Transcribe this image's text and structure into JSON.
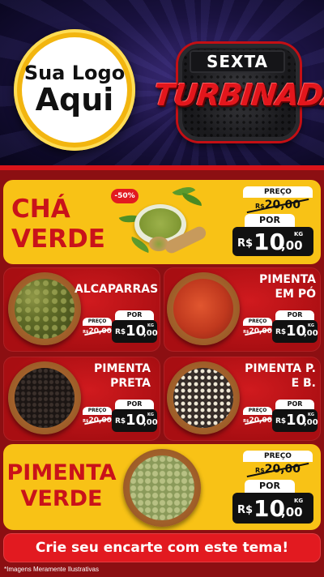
{
  "header": {
    "logo_line1": "Sua Logo",
    "logo_line2": "Aqui",
    "badge_top": "SEXTA",
    "badge_bottom": "TURBINADA"
  },
  "products": [
    {
      "name_line1": "CHÁ",
      "name_line2": "VERDE",
      "discount": "-50%",
      "preco_label": "PREÇO",
      "old_price_currency": "R$",
      "old_price": "20,00",
      "por_label": "POR",
      "currency": "R$",
      "price_int": "10",
      "price_dec": ",00",
      "unit": "KG"
    },
    {
      "name_line1": "ALCAPARRAS",
      "name_line2": "",
      "preco_label": "PREÇO",
      "old_price_currency": "R$",
      "old_price": "20,00",
      "por_label": "POR",
      "currency": "R$",
      "price_int": "10",
      "price_dec": ",00",
      "unit": "KG"
    },
    {
      "name_line1": "PIMENTA",
      "name_line2": "EM PÓ",
      "preco_label": "PREÇO",
      "old_price_currency": "R$",
      "old_price": "20,00",
      "por_label": "POR",
      "currency": "R$",
      "price_int": "10",
      "price_dec": ",00",
      "unit": "KG"
    },
    {
      "name_line1": "PIMENTA",
      "name_line2": "PRETA",
      "preco_label": "PREÇO",
      "old_price_currency": "R$",
      "old_price": "20,00",
      "por_label": "POR",
      "currency": "R$",
      "price_int": "10",
      "price_dec": ",00",
      "unit": "KG"
    },
    {
      "name_line1": "PIMENTA P.",
      "name_line2": "E B.",
      "preco_label": "PREÇO",
      "old_price_currency": "R$",
      "old_price": "20,00",
      "por_label": "POR",
      "currency": "R$",
      "price_int": "10",
      "price_dec": ",00",
      "unit": "KG"
    },
    {
      "name_line1": "PIMENTA",
      "name_line2": "VERDE",
      "preco_label": "PREÇO",
      "old_price_currency": "R$",
      "old_price": "20,00",
      "por_label": "POR",
      "currency": "R$",
      "price_int": "10",
      "price_dec": ",00",
      "unit": "KG"
    }
  ],
  "cta": "Crie seu encarte com este tema!",
  "disclaimer": "*Imagens Meramente Ilustrativas",
  "colors": {
    "red": "#d01a1e",
    "yellow": "#f8c216",
    "dark_red": "#8c0f12",
    "black": "#111111"
  }
}
